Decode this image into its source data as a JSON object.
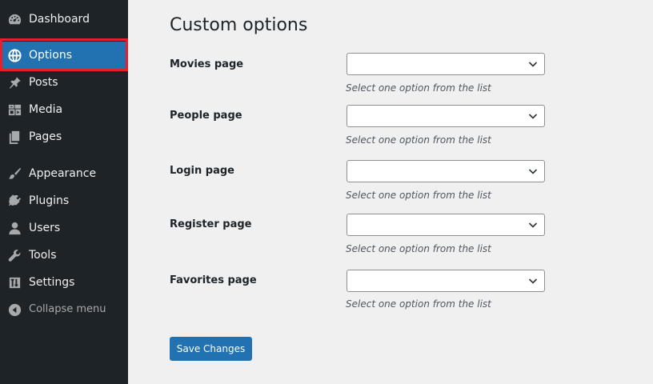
{
  "sidebar": {
    "items": [
      {
        "label": "Dashboard",
        "icon": "dashboard-icon",
        "active": false
      },
      {
        "label": "Options",
        "icon": "globe-icon",
        "active": true
      },
      {
        "label": "Posts",
        "icon": "pushpin-icon",
        "active": false
      },
      {
        "label": "Media",
        "icon": "media-icon",
        "active": false
      },
      {
        "label": "Pages",
        "icon": "pages-icon",
        "active": false
      },
      {
        "label": "Appearance",
        "icon": "paintbrush-icon",
        "active": false
      },
      {
        "label": "Plugins",
        "icon": "plug-icon",
        "active": false
      },
      {
        "label": "Users",
        "icon": "user-icon",
        "active": false
      },
      {
        "label": "Tools",
        "icon": "wrench-icon",
        "active": false
      },
      {
        "label": "Settings",
        "icon": "sliders-icon",
        "active": false
      }
    ],
    "collapse": {
      "label": "Collapse menu",
      "icon": "collapse-arrow-icon"
    },
    "colors": {
      "background": "#1d2327",
      "active": "#2271b1",
      "highlight_frame": "#e3202b"
    }
  },
  "main": {
    "title": "Custom options",
    "fields": [
      {
        "label": "Movies page",
        "value": "",
        "description": "Select one option from the list"
      },
      {
        "label": "People page",
        "value": "",
        "description": "Select one option from the list"
      },
      {
        "label": "Login page",
        "value": "",
        "description": "Select one option from the list"
      },
      {
        "label": "Register page",
        "value": "",
        "description": "Select one option from the list"
      },
      {
        "label": "Favorites page",
        "value": "",
        "description": "Select one option from the list"
      }
    ],
    "save_label": "Save Changes"
  }
}
